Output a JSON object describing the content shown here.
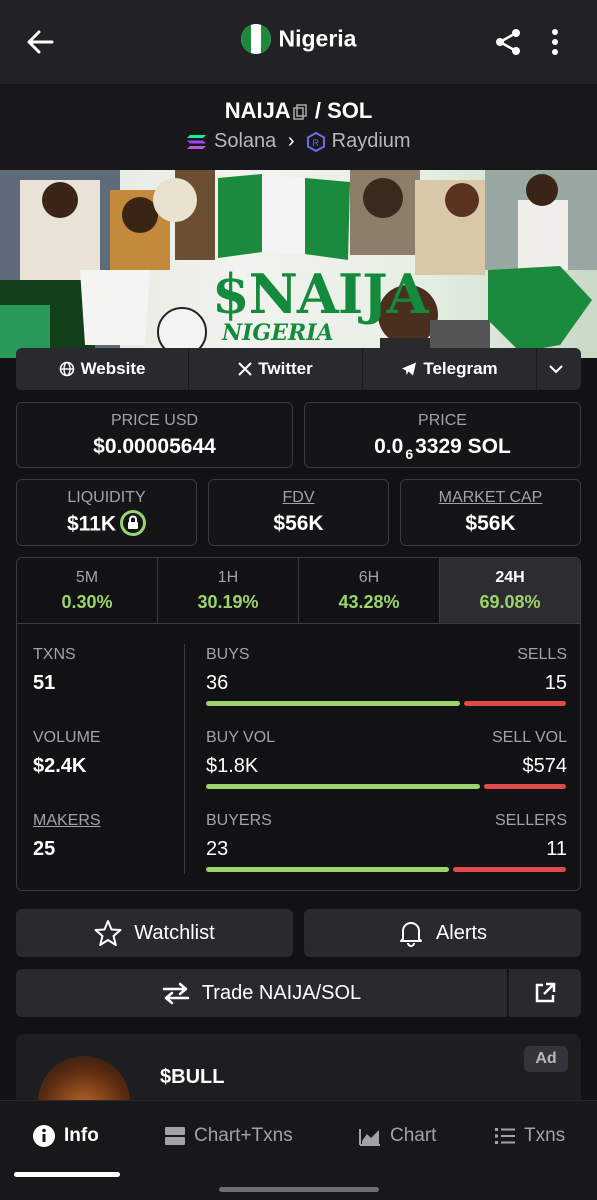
{
  "header": {
    "title": "Nigeria",
    "flag_icon": "nigeria-flag-icon"
  },
  "pair": {
    "base": "NAIJA",
    "separator": "/",
    "quote": "SOL",
    "chain": "Solana",
    "dex": "Raydium"
  },
  "banner": {
    "headline": "$NAIJA",
    "subline": "NIGERIA"
  },
  "links": {
    "website": "Website",
    "twitter": "Twitter",
    "telegram": "Telegram"
  },
  "price": {
    "usd_label": "PRICE USD",
    "usd_value": "$0.00005644",
    "native_label": "PRICE",
    "native_prefix": "0.0",
    "native_zeros": "6",
    "native_digits": "3329 SOL"
  },
  "metrics": {
    "liquidity_label": "LIQUIDITY",
    "liquidity_value": "$11K",
    "fdv_label": "FDV",
    "fdv_value": "$56K",
    "mcap_label": "MARKET CAP",
    "mcap_value": "$56K"
  },
  "timeframes": [
    {
      "label": "5M",
      "change": "0.30%"
    },
    {
      "label": "1H",
      "change": "30.19%"
    },
    {
      "label": "6H",
      "change": "43.28%"
    },
    {
      "label": "24H",
      "change": "69.08%"
    }
  ],
  "stats": {
    "txns_label": "TXNS",
    "txns_value": "51",
    "volume_label": "VOLUME",
    "volume_value": "$2.4K",
    "makers_label": "MAKERS",
    "makers_value": "25",
    "buys_label": "BUYS",
    "buys_value": "36",
    "sells_label": "SELLS",
    "sells_value": "15",
    "buy_vol_label": "BUY VOL",
    "buy_vol_value": "$1.8K",
    "sell_vol_label": "SELL VOL",
    "sell_vol_value": "$574",
    "buyers_label": "BUYERS",
    "buyers_value": "23",
    "sellers_label": "SELLERS",
    "sellers_value": "11"
  },
  "actions": {
    "watchlist": "Watchlist",
    "alerts": "Alerts",
    "trade": "Trade NAIJA/SOL"
  },
  "ad": {
    "name": "$BULL",
    "badge": "Ad"
  },
  "tabs": [
    {
      "label": "Info",
      "icon": "info-icon"
    },
    {
      "label": "Chart+Txns",
      "icon": "chart-txns-icon"
    },
    {
      "label": "Chart",
      "icon": "chart-icon"
    },
    {
      "label": "Txns",
      "icon": "list-icon"
    }
  ],
  "colors": {
    "positive": "#9bd36c",
    "negative": "#e04a4a",
    "background": "#121214"
  }
}
